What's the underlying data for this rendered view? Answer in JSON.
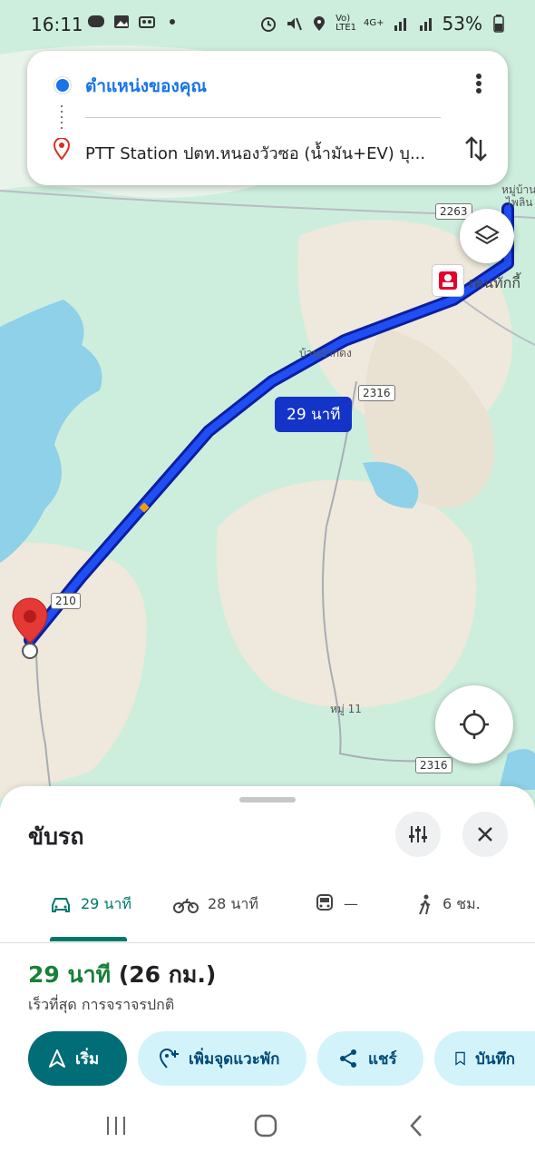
{
  "status_bar": {
    "time": "16:11",
    "network": "4G+",
    "battery": "53%"
  },
  "directions": {
    "origin": "ตำแหน่งของคุณ",
    "destination": "PTT Station ปตท.หนองวัวซอ (น้ำมัน+EV) บุ..."
  },
  "map": {
    "route_time_label": "29 นาที",
    "labels": {
      "village": "บ้านป่ากดง",
      "moo11": "หมู่ 11",
      "moo_top": "หมู่บ้าน",
      "moo_top2": "ไพลิน",
      "kfc": "เคนทักกี้"
    },
    "road_shields": [
      "2263",
      "2316",
      "210",
      "2316"
    ],
    "route_color": "#1433c7"
  },
  "sheet": {
    "title": "ขับรถ",
    "modes": [
      {
        "icon": "car-icon",
        "label": "29 นาที"
      },
      {
        "icon": "motorcycle-icon",
        "label": "28 นาที"
      },
      {
        "icon": "transit-icon",
        "label": "—"
      },
      {
        "icon": "walk-icon",
        "label": "6 ชม."
      }
    ],
    "duration_time": "29 นาที",
    "duration_distance": "(26 กม.)",
    "subtitle": "เร็วที่สุด การจราจรปกติ",
    "actions": [
      {
        "icon": "navigation-arrow-icon",
        "label": "เริ่ม"
      },
      {
        "icon": "add-stop-icon",
        "label": "เพิ่มจุดแวะพัก"
      },
      {
        "icon": "share-icon",
        "label": "แชร์"
      },
      {
        "icon": "bookmark-icon",
        "label": "บันทึก"
      }
    ]
  },
  "colors": {
    "accent_teal": "#006d77",
    "route_blue": "#1433c7",
    "duration_green": "#188038"
  }
}
